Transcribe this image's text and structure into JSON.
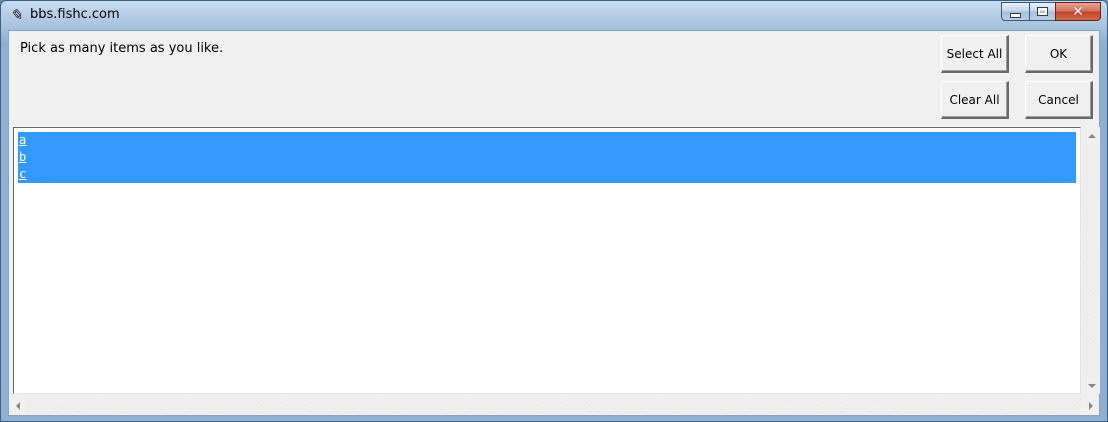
{
  "window": {
    "title": "bbs.fishc.com",
    "icon": "feather-icon",
    "caption_icons": [
      "minimize-icon",
      "maximize-icon",
      "close-icon"
    ]
  },
  "dialog": {
    "prompt": "Pick as many items as you like.",
    "buttons": {
      "select_all": "Select All",
      "ok": "OK",
      "clear_all": "Clear All",
      "cancel": "Cancel"
    }
  },
  "listbox": {
    "items": [
      "a",
      "b",
      "c"
    ],
    "selected": [
      "a",
      "b",
      "c"
    ],
    "selection_color": "#3399ff"
  }
}
